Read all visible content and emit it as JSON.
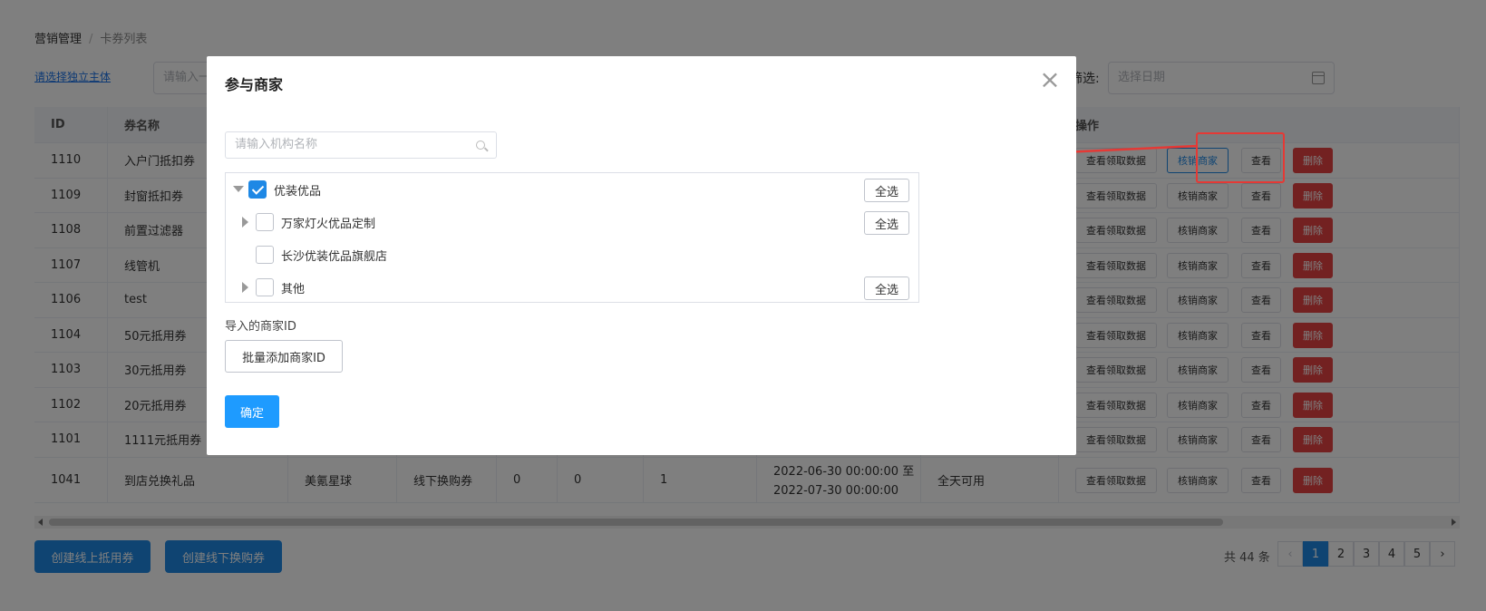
{
  "breadcrumb": {
    "parent": "营销管理",
    "separator": "/",
    "current": "卡券列表"
  },
  "toolbar": {
    "select_entity_link": "请选择独立主体",
    "name_input_placeholder": "请输入一",
    "filter_label": "筛选:",
    "date_placeholder": "选择日期"
  },
  "table": {
    "headers": [
      "ID",
      "券名称",
      "",
      "",
      "",
      "",
      "",
      "",
      "",
      "操作"
    ],
    "rows": [
      {
        "id": "1110",
        "name": "入户门抵扣券",
        "c3": "",
        "c4": "",
        "c5": "",
        "c6": "",
        "c7": "",
        "c8": "",
        "c9": ""
      },
      {
        "id": "1109",
        "name": "封窗抵扣券",
        "c3": "",
        "c4": "",
        "c5": "",
        "c6": "",
        "c7": "",
        "c8": "",
        "c9": ""
      },
      {
        "id": "1108",
        "name": "前置过滤器",
        "c3": "",
        "c4": "",
        "c5": "",
        "c6": "",
        "c7": "",
        "c8": "",
        "c9": ""
      },
      {
        "id": "1107",
        "name": "线管机",
        "c3": "",
        "c4": "",
        "c5": "",
        "c6": "",
        "c7": "",
        "c8": "",
        "c9": ""
      },
      {
        "id": "1106",
        "name": "test",
        "c3": "",
        "c4": "",
        "c5": "",
        "c6": "",
        "c7": "",
        "c8": "",
        "c9": ""
      },
      {
        "id": "1104",
        "name": "50元抵用券",
        "c3": "",
        "c4": "",
        "c5": "",
        "c6": "",
        "c7": "",
        "c8": "",
        "c9": ""
      },
      {
        "id": "1103",
        "name": "30元抵用券",
        "c3": "",
        "c4": "",
        "c5": "",
        "c6": "",
        "c7": "",
        "c8": "",
        "c9": ""
      },
      {
        "id": "1102",
        "name": "20元抵用券",
        "c3": "",
        "c4": "",
        "c5": "",
        "c6": "",
        "c7": "",
        "c8": "",
        "c9": ""
      },
      {
        "id": "1101",
        "name": "1111元抵用券",
        "c3": "",
        "c4": "",
        "c5": "",
        "c6": "",
        "c7": "",
        "c8": "",
        "c9": ""
      },
      {
        "id": "1041",
        "name": "到店兑换礼品",
        "c3": "美氪星球",
        "c4": "线下换购券",
        "c5": "0",
        "c6": "0",
        "c7": "1",
        "c8": "2022-06-30 00:00:00 至",
        "c8b": "2022-07-30 00:00:00",
        "c9": "全天可用"
      }
    ],
    "actions": {
      "view_data": "查看领取数据",
      "verify_merchant": "核销商家",
      "view": "查看",
      "delete": "删除"
    }
  },
  "bottom": {
    "create_online_btn": "创建线上抵用券",
    "create_offline_btn": "创建线下换购券"
  },
  "pagination": {
    "total": "共 44 条",
    "pages": [
      "1",
      "2",
      "3",
      "4",
      "5"
    ],
    "current": "1",
    "next": "›",
    "prev": "‹"
  },
  "modal": {
    "title": "参与商家",
    "close": "×",
    "search_placeholder": "请输入机构名称",
    "tree": [
      {
        "label": "优装优品",
        "checked": true,
        "expanded": true,
        "select_all": "全选"
      },
      {
        "label": "万家灯火优品定制",
        "checked": false,
        "select_all": "全选"
      },
      {
        "label": "长沙优装优品旗舰店",
        "checked": false
      },
      {
        "label": "其他",
        "checked": false,
        "select_all": "全选"
      }
    ],
    "import_label": "导入的商家ID",
    "batch_add_btn": "批量添加商家ID",
    "confirm_btn": "确定"
  },
  "colors": {
    "primary": "#1e88e5",
    "danger": "#e64242",
    "annotation": "#e53935"
  }
}
